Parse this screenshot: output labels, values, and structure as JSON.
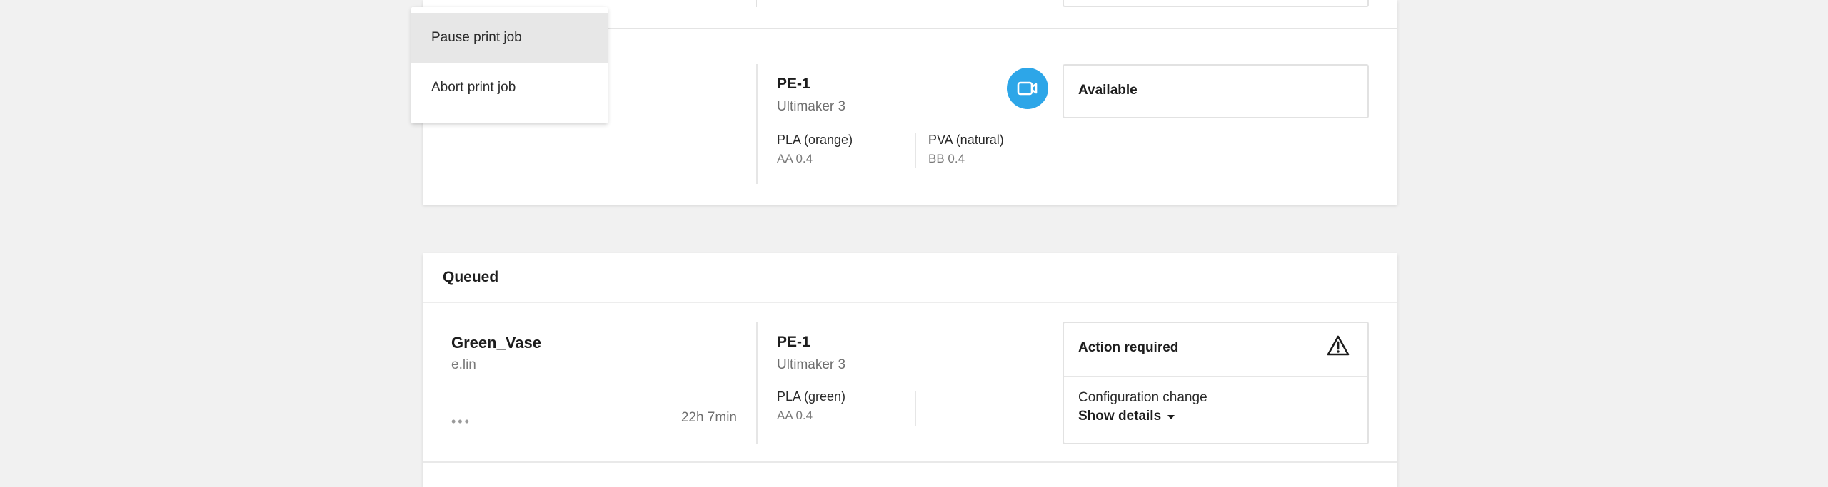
{
  "context_menu": {
    "items": [
      {
        "label": "Pause print job"
      },
      {
        "label": "Abort print job"
      }
    ]
  },
  "printer_card": {
    "printer_name": "PE-1",
    "printer_model": "Ultimaker 3",
    "extruders": [
      {
        "material": "PLA (orange)",
        "core": "AA 0.4"
      },
      {
        "material": "PVA (natural)",
        "core": "BB 0.4"
      }
    ],
    "status": "Available",
    "camera_icon": "camera-icon",
    "accent_color": "#2da6e8"
  },
  "queued": {
    "title": "Queued",
    "jobs": [
      {
        "name": "Green_Vase",
        "owner": "e.lin",
        "more": "•••",
        "duration": "22h 7min",
        "printer_name": "PE-1",
        "printer_model": "Ultimaker 3",
        "extruders": [
          {
            "material": "PLA (green)",
            "core": "AA 0.4"
          }
        ],
        "status": {
          "title": "Action required",
          "icon": "warning-icon",
          "detail": "Configuration change",
          "show_details_label": "Show details"
        }
      }
    ]
  }
}
